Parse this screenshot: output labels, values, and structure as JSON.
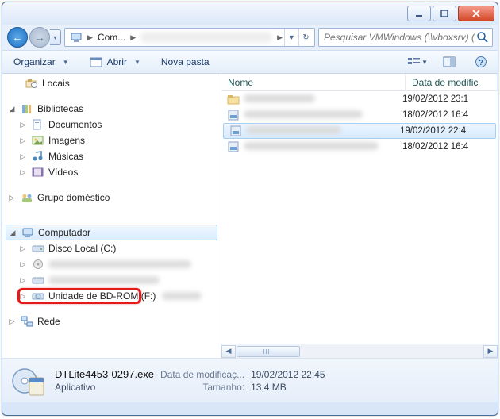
{
  "titlebar": {
    "min": "▁",
    "max": "▢",
    "close": "✕"
  },
  "nav": {
    "back": "←",
    "forward": "→",
    "dropdown": "▾"
  },
  "address": {
    "segment1": "Com...",
    "refresh": "↻",
    "history": "▾"
  },
  "search": {
    "placeholder": "Pesquisar VMWindows (\\\\vboxsrv) (E:)"
  },
  "toolbar": {
    "organize": "Organizar",
    "open": "Abrir",
    "newfolder": "Nova pasta"
  },
  "navpane": {
    "locais": "Locais",
    "bibliotecas": "Bibliotecas",
    "documentos": "Documentos",
    "imagens": "Imagens",
    "musicas": "Músicas",
    "videos": "Vídeos",
    "grupo": "Grupo doméstico",
    "computador": "Computador",
    "disco_c": "Disco Local (C:)",
    "bdrom": "Unidade de BD-ROM (F:)",
    "rede": "Rede"
  },
  "columns": {
    "name": "Nome",
    "date": "Data de modific"
  },
  "files": {
    "row0_date": "19/02/2012 23:1",
    "row1_date": "18/02/2012 16:4",
    "row2_date": "19/02/2012 22:4",
    "row3_date": "18/02/2012 16:4"
  },
  "details": {
    "filename": "DTLite4453-0297.exe",
    "date_k": "Data de modificaç...",
    "date_v": "19/02/2012 22:45",
    "type": "Aplicativo",
    "size_k": "Tamanho:",
    "size_v": "13,4 MB"
  }
}
